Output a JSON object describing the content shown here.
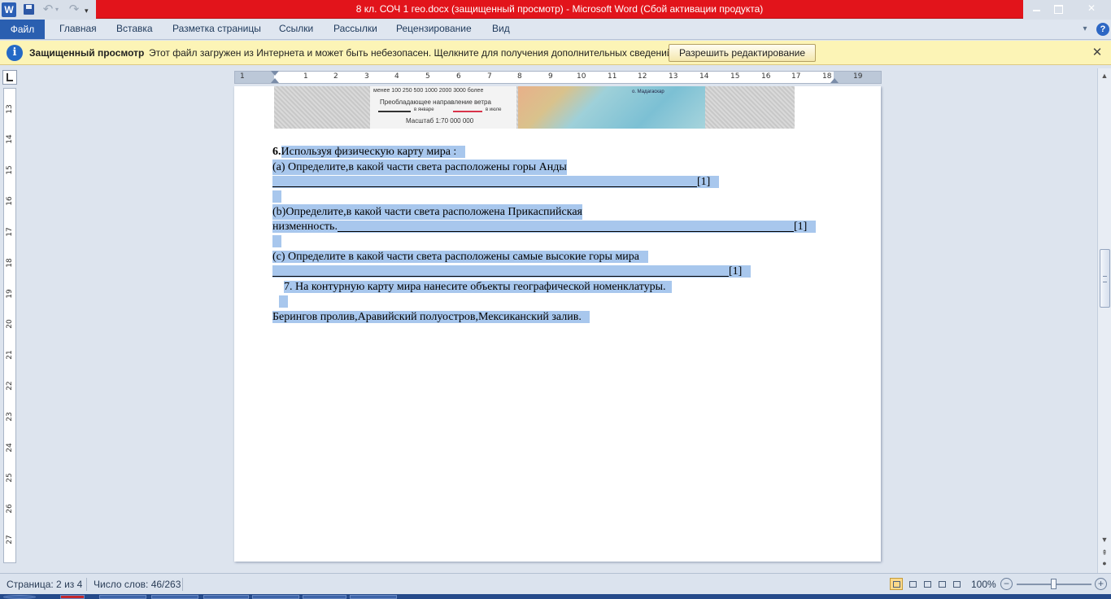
{
  "window": {
    "title": "8 кл. СОЧ 1 гео.docx (защищенный просмотр) - Microsoft Word (Сбой активации продукта)",
    "app_icon_letter": "W"
  },
  "menu": {
    "tabs": [
      "Файл",
      "Главная",
      "Вставка",
      "Разметка страницы",
      "Ссылки",
      "Рассылки",
      "Рецензирование",
      "Вид"
    ]
  },
  "protected_view": {
    "title": "Защищенный просмотр",
    "message": "Этот файл загружен из Интернета и может быть небезопасен. Щелкните для получения дополнительных сведений.",
    "enable_button": "Разрешить редактирование"
  },
  "ruler": {
    "h_ticks": [
      "1",
      "1",
      "2",
      "3",
      "4",
      "5",
      "6",
      "7",
      "8",
      "9",
      "10",
      "11",
      "12",
      "13",
      "14",
      "15",
      "16",
      "17",
      "18",
      "19"
    ],
    "v_ticks": [
      "13",
      "14",
      "15",
      "16",
      "17",
      "18",
      "19",
      "20",
      "21",
      "22",
      "23",
      "24",
      "25",
      "26",
      "27"
    ]
  },
  "map": {
    "legend_numbers": "менее 100   250   500   1000   2000   3000 более",
    "wind_title": "Преобладающее направление ветра",
    "jan_label": "в январе",
    "jul_label": "в июле",
    "scale": "Масштаб 1:70 000 000",
    "place_label": "о. Мадагаскар"
  },
  "document": {
    "q6_num": "6.",
    "q6_text": "Используя физическую  карту мира :",
    "q6a": "(a)  Определите,в какой части света расположены горы Анды",
    "mark_a": "[1]",
    "q6b": "(b)Определите,в какой части света расположена Прикаспийская",
    "q6b_cont": "низменность.",
    "mark_b": "[1]",
    "q6c": "(c)  Определите в какой части света расположены самые высокие горы мира",
    "mark_c": "[1]",
    "q7": "7. На контурную карту мира нанесите объекты географической номенклатуры.",
    "objects": "Берингов пролив,Аравийский полуостров,Мексиканский залив."
  },
  "status": {
    "page": "Страница: 2 из 4",
    "words": "Число слов: 46/263",
    "zoom": "100%"
  },
  "colors": {
    "title_bar_error": "#e2141b",
    "selection": "#a8c7ed",
    "protected_bar": "#fcf4b6",
    "file_tab": "#2a5fb0"
  }
}
